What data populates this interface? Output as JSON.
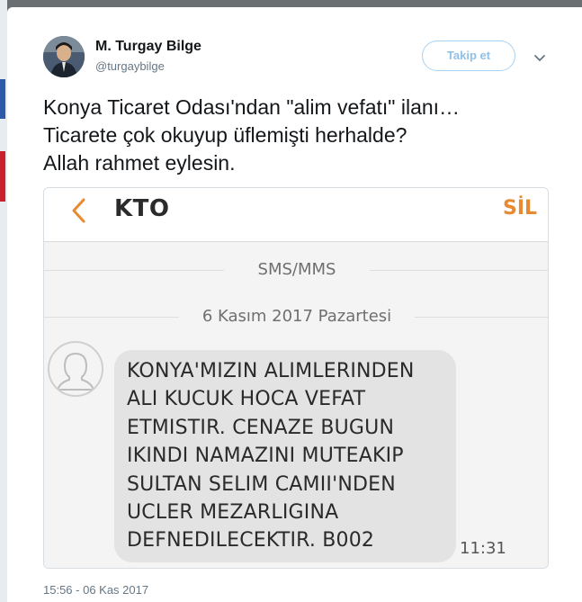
{
  "tweet": {
    "display_name": "M. Turgay Bilge",
    "handle": "@turgaybilge",
    "follow_label": "Takip et",
    "text": "Konya Ticaret Odası'ndan \"alim vefatı\" ilanı…\nTicarete çok okuyup üflemişti herhalde?\nAllah rahmet eylesin.",
    "timestamp": "15:56 - 06 Kas 2017",
    "accent_color": "#1da1f2"
  },
  "sms_screenshot": {
    "sender": "KTO",
    "delete_label": "SİL",
    "section_label": "SMS/MMS",
    "date_label": "6 Kasım 2017 Pazartesi",
    "message": "KONYA'MIZIN ALIMLERINDEN\nALI KUCUK HOCA VEFAT\nETMISTIR. CENAZE BUGUN\nIKINDI NAMAZINI MUTEAKIP\nSULTAN SELIM CAMII'NDEN\nUCLER MEZARLIGINA\nDEFNEDILECEKTIR. B002",
    "time": "11:31",
    "accent_color": "#e88a2f"
  },
  "icons": {
    "caret": "chevron-down-icon",
    "back": "back-arrow-icon",
    "contact": "contact-avatar-icon"
  }
}
